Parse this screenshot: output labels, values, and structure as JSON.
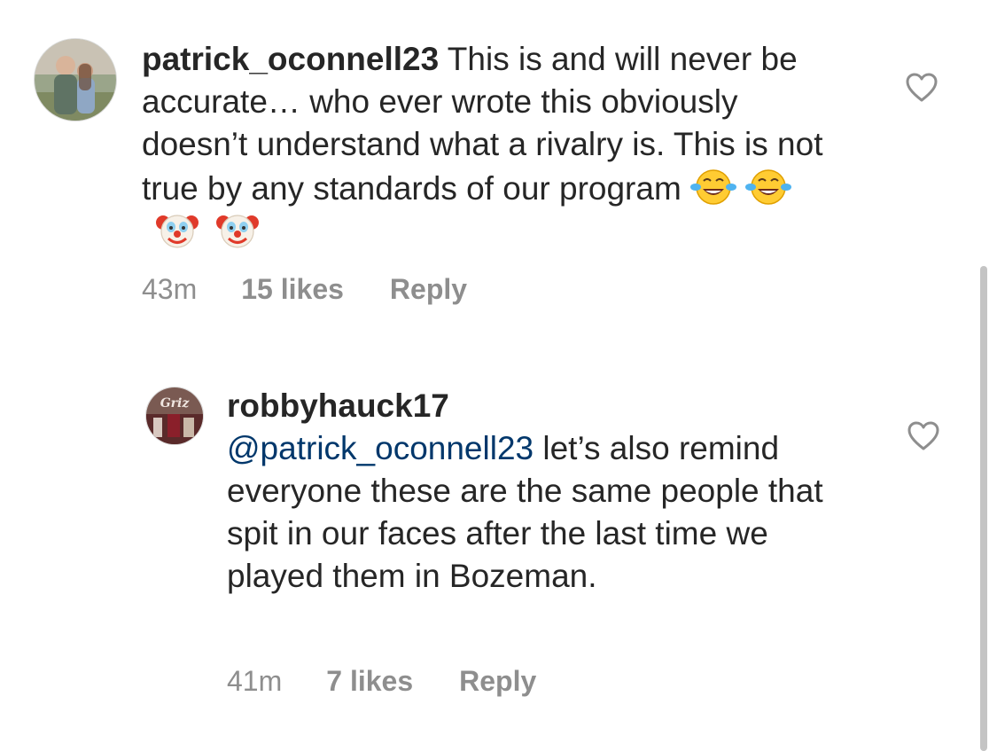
{
  "comments": [
    {
      "username": "patrick_oconnell23",
      "text": " This is and will never be accurate… who ever wrote this obviously doesn’t understand what a rivalry is. This is not true by any standards of our program ",
      "emojis": [
        "face-with-tears-of-joy-icon",
        "face-with-tears-of-joy-icon",
        "clown-face-icon",
        "clown-face-icon"
      ],
      "time": "43m",
      "likes": "15 likes",
      "reply": "Reply"
    },
    {
      "username": "robbyhauck17",
      "mention": "@patrick_oconnell23",
      "text": " let’s also remind everyone these are the same people that spit in our faces after the last time we played them in Bozeman.",
      "time": "41m",
      "likes": "7 likes",
      "reply": "Reply"
    }
  ],
  "colors": {
    "text": "#262626",
    "meta": "#8e8e8e",
    "mention": "#00376b",
    "scrollbar": "#c4c4c4"
  }
}
